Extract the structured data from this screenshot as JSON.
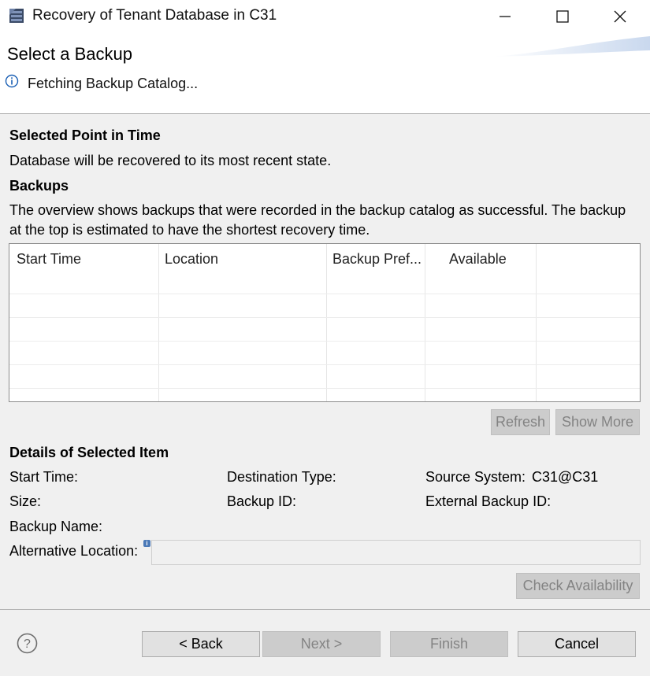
{
  "window": {
    "title": "Recovery of Tenant Database in C31",
    "controls": {
      "minimize": "minimize",
      "maximize": "maximize",
      "close": "close"
    }
  },
  "header": {
    "page_title": "Select a Backup",
    "status_message": "Fetching Backup Catalog..."
  },
  "point_in_time": {
    "title": "Selected Point in Time",
    "description": "Database will be recovered to its most recent state."
  },
  "backups": {
    "title": "Backups",
    "description_line1": "The overview shows backups that were recorded in the backup catalog as successful. The backup",
    "description_line2": "at the top is estimated to have the shortest recovery time.",
    "columns": [
      "Start Time",
      "Location",
      "Backup Pref...",
      "Available"
    ],
    "rows": [],
    "refresh_label": "Refresh",
    "show_more_label": "Show More"
  },
  "details": {
    "title": "Details of Selected Item",
    "start_time_label": "Start Time:",
    "destination_type_label": "Destination Type:",
    "source_system_label": "Source System:",
    "source_system_value": "C31@C31",
    "size_label": "Size:",
    "backup_id_label": "Backup ID:",
    "external_backup_id_label": "External Backup ID:",
    "backup_name_label": "Backup Name:",
    "alternative_location_label": "Alternative Location:",
    "alternative_location_value": "",
    "check_availability_label": "Check Availability"
  },
  "footer": {
    "back_label": "< Back",
    "next_label": "Next >",
    "finish_label": "Finish",
    "cancel_label": "Cancel"
  },
  "icons": {
    "app": "database-recovery-icon",
    "info": "info-icon",
    "help": "help-icon"
  },
  "colors": {
    "accent": "#1a5fb4",
    "disabled_text": "#838383",
    "disabled_button": "#cccccc"
  }
}
